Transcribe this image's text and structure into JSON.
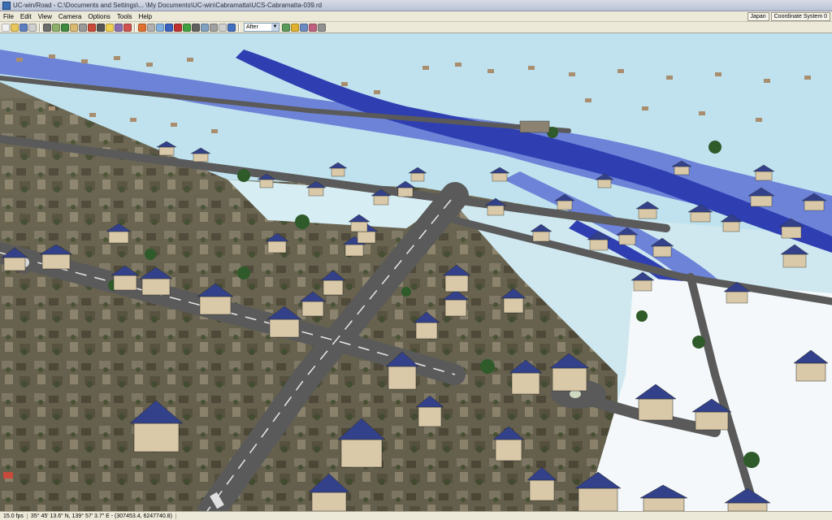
{
  "window": {
    "title": "UC-win/Road - C:\\Documents and Settings\\... \\My Documents\\UC-win\\Cabramatta\\UCS-Cabramatta-039.rd"
  },
  "menu": {
    "items": [
      "File",
      "Edit",
      "View",
      "Camera",
      "Options",
      "Tools",
      "Help"
    ],
    "region_button": "Japan",
    "coordinate_button": "Coordinate System 0"
  },
  "toolbar": {
    "scenario_select": "After",
    "icons": [
      "new-file-icon",
      "open-file-icon",
      "save-icon",
      "print-icon",
      "road-icon",
      "terrain-icon",
      "tree-icon",
      "road-edit-icon",
      "intersection-icon",
      "car-icon",
      "camera-icon",
      "light-icon",
      "scenario-icon",
      "flag-icon",
      "sign-icon",
      "grid-icon",
      "sky-icon",
      "water-icon",
      "record-icon",
      "play-icon",
      "stop-icon",
      "rotate-icon",
      "move-icon",
      "view-icon",
      "help-icon"
    ],
    "right_icons": [
      "pause-icon",
      "play-forward-icon",
      "rain-icon",
      "wireframe-icon",
      "2d-view-icon"
    ]
  },
  "status": {
    "fps": "15.0 fps",
    "coordinates": "35° 45' 13.6\" N, 139° 57' 3.7\" E - (307453.4, 6247740.8)"
  },
  "colors": {
    "flood_deep": "#2f3fb2",
    "flood_mid": "#6c83d8",
    "flood_shallow": "#bfe2ee",
    "road": "#5a5a5a",
    "roof": "#33418a"
  }
}
